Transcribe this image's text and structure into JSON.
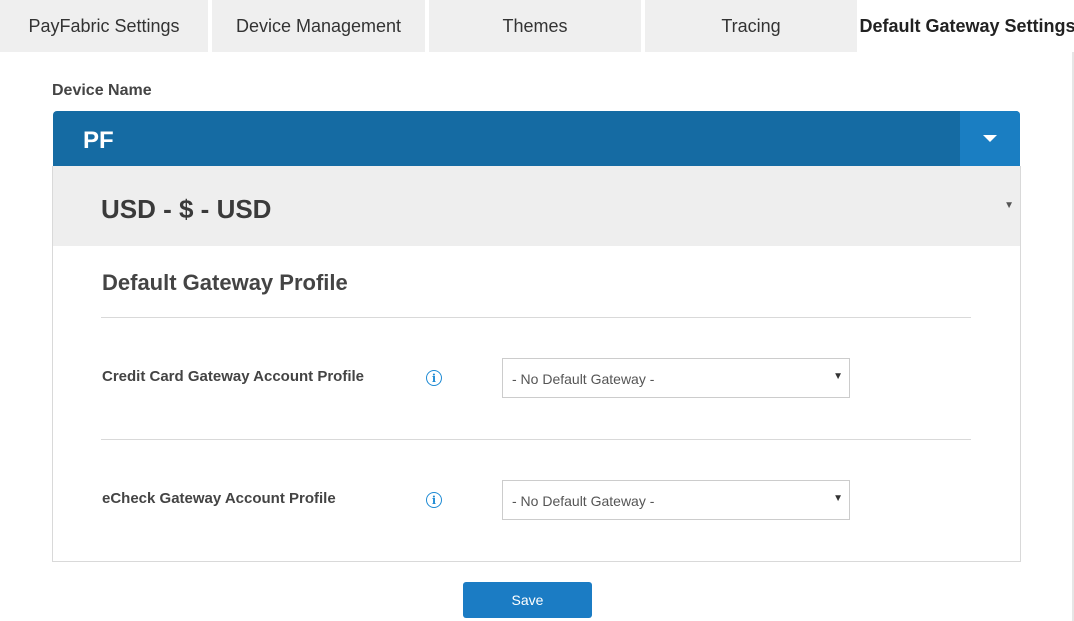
{
  "tabs": [
    {
      "label": "PayFabric Settings",
      "active": false
    },
    {
      "label": "Device Management",
      "active": false
    },
    {
      "label": "Themes",
      "active": false
    },
    {
      "label": "Tracing",
      "active": false
    },
    {
      "label": "Default Gateway Settings",
      "active": true
    }
  ],
  "device": {
    "label": "Device Name",
    "selected": "PF"
  },
  "currency": {
    "selected": "USD - $ - USD"
  },
  "gateway_profile": {
    "title": "Default Gateway Profile",
    "credit_card": {
      "label": "Credit Card Gateway Account Profile",
      "selected": "- No Default Gateway -"
    },
    "echeck": {
      "label": "eCheck Gateway Account Profile",
      "selected": "- No Default Gateway -"
    }
  },
  "actions": {
    "save_label": "Save"
  },
  "icons": {
    "info": "info-icon",
    "dropdown": "chevron-down-icon"
  },
  "colors": {
    "primary": "#156ba3",
    "primary_light": "#1a7ec2",
    "button": "#1b7cc4",
    "info": "#1f8bd4",
    "tab_bg": "#efefef",
    "currency_bg": "#eeeeee"
  }
}
